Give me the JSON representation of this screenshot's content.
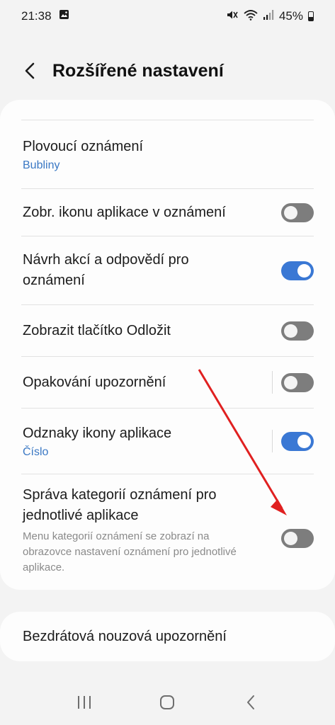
{
  "status_bar": {
    "time": "21:38",
    "battery": "45%",
    "icons": [
      "image-icon",
      "mute-icon",
      "wifi-icon",
      "signal-icon",
      "battery-icon"
    ]
  },
  "header": {
    "title": "Rozšířené nastavení",
    "back_icon": "chevron-left-icon"
  },
  "settings": {
    "items": [
      {
        "label": "Plovoucí oznámení",
        "sub": "Bubliny"
      },
      {
        "label": "Zobr. ikonu aplikace v oznámení",
        "toggle": "off"
      },
      {
        "label": "Návrh akcí a odpovědí pro oznámení",
        "toggle": "on"
      },
      {
        "label": "Zobrazit tlačítko Odložit",
        "toggle": "off"
      },
      {
        "label": "Opakování upozornění",
        "toggle": "off"
      },
      {
        "label": "Odznaky ikony aplikace",
        "sub": "Číslo",
        "toggle": "on"
      },
      {
        "label": "Správa kategorií oznámení pro jednotlivé aplikace",
        "desc": "Menu kategorií oznámení se zobrazí na obrazovce nastavení oznámení pro jednotlivé aplikace.",
        "toggle": "off"
      }
    ]
  },
  "second_card": {
    "label": "Bezdrátová nouzová upozornění"
  },
  "navigation": {
    "buttons": [
      "recents-icon",
      "home-icon",
      "back-icon"
    ]
  },
  "colors": {
    "accent": "#3a78d4",
    "sub_text": "#3a78c4",
    "toggle_off": "#7d7d7d",
    "annotation_arrow": "#e02020",
    "background": "#f3f3f3"
  }
}
